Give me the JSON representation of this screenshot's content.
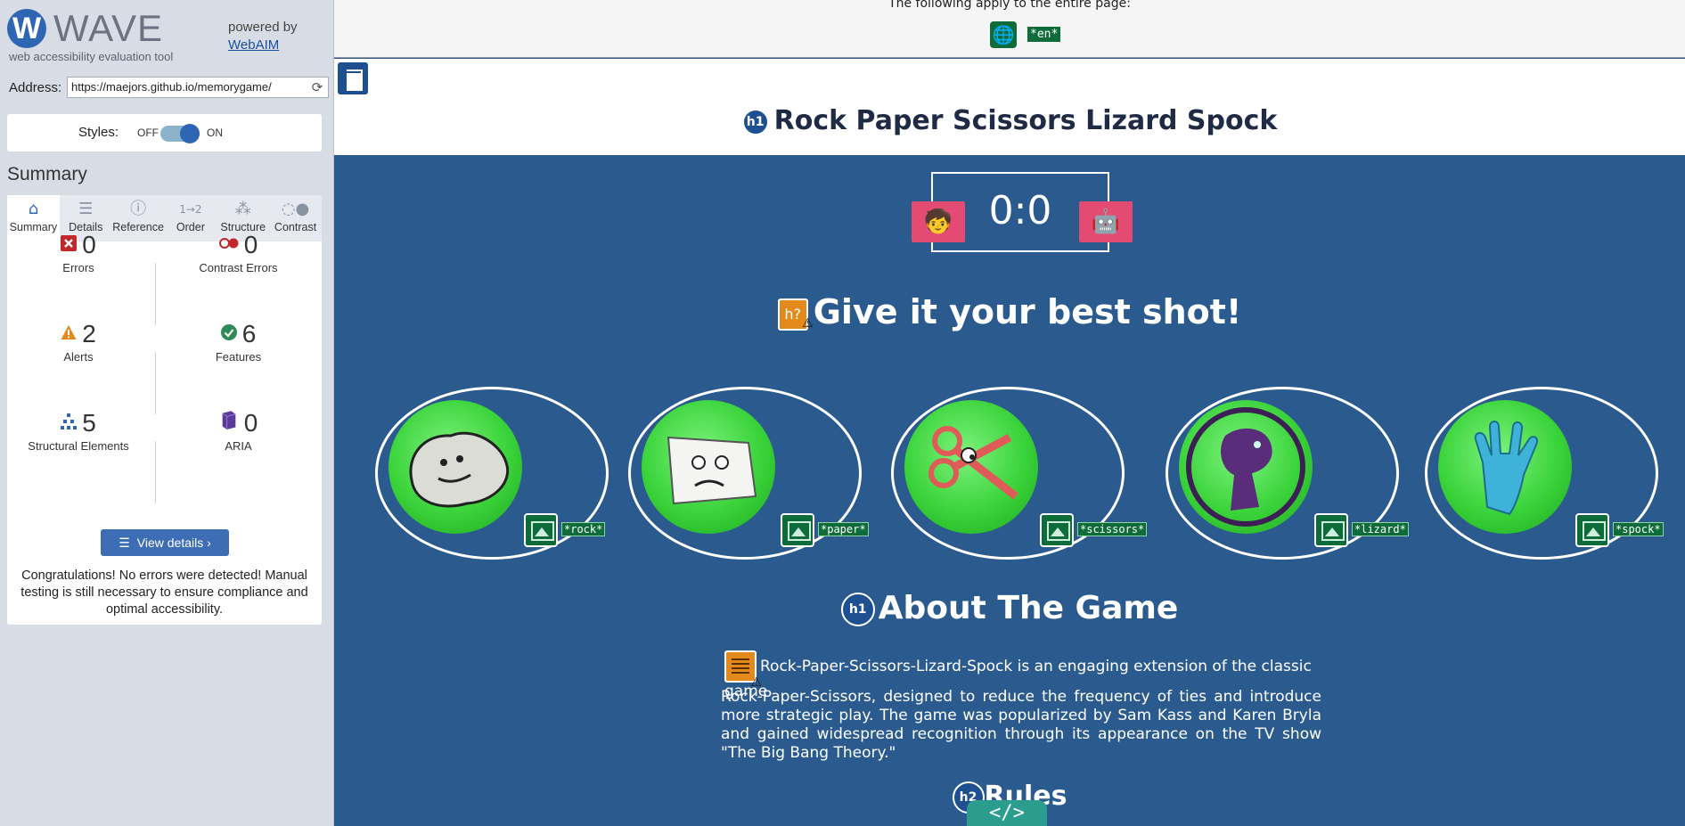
{
  "wave": {
    "logo_letter": "W",
    "logo_text": "WAVE",
    "tagline": "web accessibility evaluation tool",
    "powered_by": "powered by",
    "webaim_link": "WebAIM",
    "address_label": "Address:",
    "address_value": "https://maejors.github.io/memorygame/",
    "styles_label": "Styles:",
    "styles_off": "OFF",
    "styles_on": "ON",
    "styles_enabled": true,
    "summary_title": "Summary",
    "tabs": [
      {
        "label": "Summary",
        "icon": "home-icon",
        "active": true
      },
      {
        "label": "Details",
        "icon": "list-icon",
        "active": false
      },
      {
        "label": "Reference",
        "icon": "info-icon",
        "active": false
      },
      {
        "label": "Order",
        "icon": "order-icon",
        "active": false
      },
      {
        "label": "Structure",
        "icon": "structure-icon",
        "active": false
      },
      {
        "label": "Contrast",
        "icon": "contrast-icon",
        "active": false
      }
    ],
    "stats": {
      "errors": {
        "count": "0",
        "label": "Errors",
        "color": "#c1272d"
      },
      "contrast_errors": {
        "count": "0",
        "label": "Contrast Errors",
        "color": "#c1272d"
      },
      "alerts": {
        "count": "2",
        "label": "Alerts",
        "color": "#e48a1c"
      },
      "features": {
        "count": "6",
        "label": "Features",
        "color": "#2e8b57"
      },
      "structural": {
        "count": "5",
        "label": "Structural Elements",
        "color": "#2f66b3"
      },
      "aria": {
        "count": "0",
        "label": "ARIA",
        "color": "#5b3a99"
      }
    },
    "view_details_label": "View details ›",
    "congrats": "Congratulations! No errors were detected! Manual testing is still necessary to ensure compliance and optimal accessibility."
  },
  "page": {
    "top_text": "The following apply to the entire page:",
    "lang_tag": "*en*",
    "title_badge": "h1",
    "title": "Rock Paper Scissors Lizard Spock",
    "score": "0:0",
    "player_avatar": "🧒",
    "robot_avatar": "🤖",
    "shot_badge": "h?",
    "shot_heading": "Give it your best shot!",
    "choices": [
      {
        "name": "rock",
        "alt": "*rock*",
        "glyph": "🪨"
      },
      {
        "name": "paper",
        "alt": "*paper*",
        "glyph": "📄"
      },
      {
        "name": "scissors",
        "alt": "*scissors*",
        "glyph": "✂️"
      },
      {
        "name": "lizard",
        "alt": "*lizard*",
        "glyph": "🦖"
      },
      {
        "name": "spock",
        "alt": "*spock*",
        "glyph": "🖖"
      }
    ],
    "about_badge": "h1",
    "about_heading": "About The Game",
    "about_first_line": "Rock-Paper-Scissors-Lizard-Spock is an engaging extension of the classic game",
    "about_rest": "Rock-Paper-Scissors, designed to reduce the frequency of ties and introduce more strategic play. The game was popularized by Sam Kass and Karen Bryla and gained widespread recognition through its appearance on the TV show \"The Big Bang Theory.\"",
    "rules_badge": "h2",
    "rules_heading": "Rules",
    "code_tab": "</>"
  },
  "colors": {
    "page_background": "#2a5a8e",
    "accent_blue": "#2f66b3",
    "feature_green": "#0e6b3a",
    "alert_orange": "#e48a1c",
    "avatar_pink": "#e34b73"
  }
}
